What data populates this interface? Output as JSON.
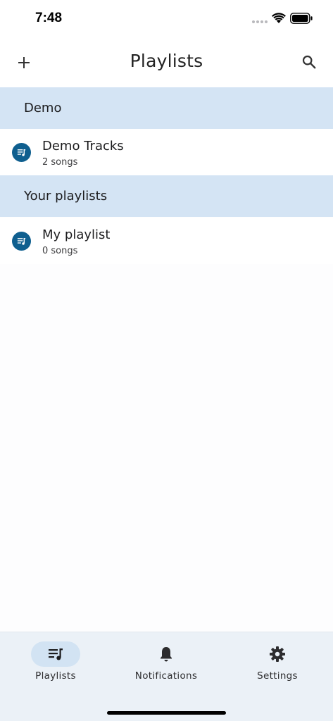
{
  "status_bar": {
    "time": "7:48"
  },
  "header": {
    "title": "Playlists",
    "add_icon": "plus-icon",
    "search_icon": "search-icon"
  },
  "sections": [
    {
      "label": "Demo",
      "items": [
        {
          "title": "Demo Tracks",
          "subtitle": "2 songs",
          "icon": "playlist-icon"
        }
      ]
    },
    {
      "label": "Your playlists",
      "items": [
        {
          "title": "My playlist",
          "subtitle": "0 songs",
          "icon": "playlist-icon"
        }
      ]
    }
  ],
  "tabs": [
    {
      "label": "Playlists",
      "icon": "playlist-icon",
      "active": true
    },
    {
      "label": "Notifications",
      "icon": "bell-icon",
      "active": false
    },
    {
      "label": "Settings",
      "icon": "gear-icon",
      "active": false
    }
  ],
  "colors": {
    "accent": "#0f5f8f",
    "section_bg": "#d4e4f4",
    "tab_bar_bg": "#ebf1f7",
    "active_tab_pill": "#d2e3f3"
  }
}
